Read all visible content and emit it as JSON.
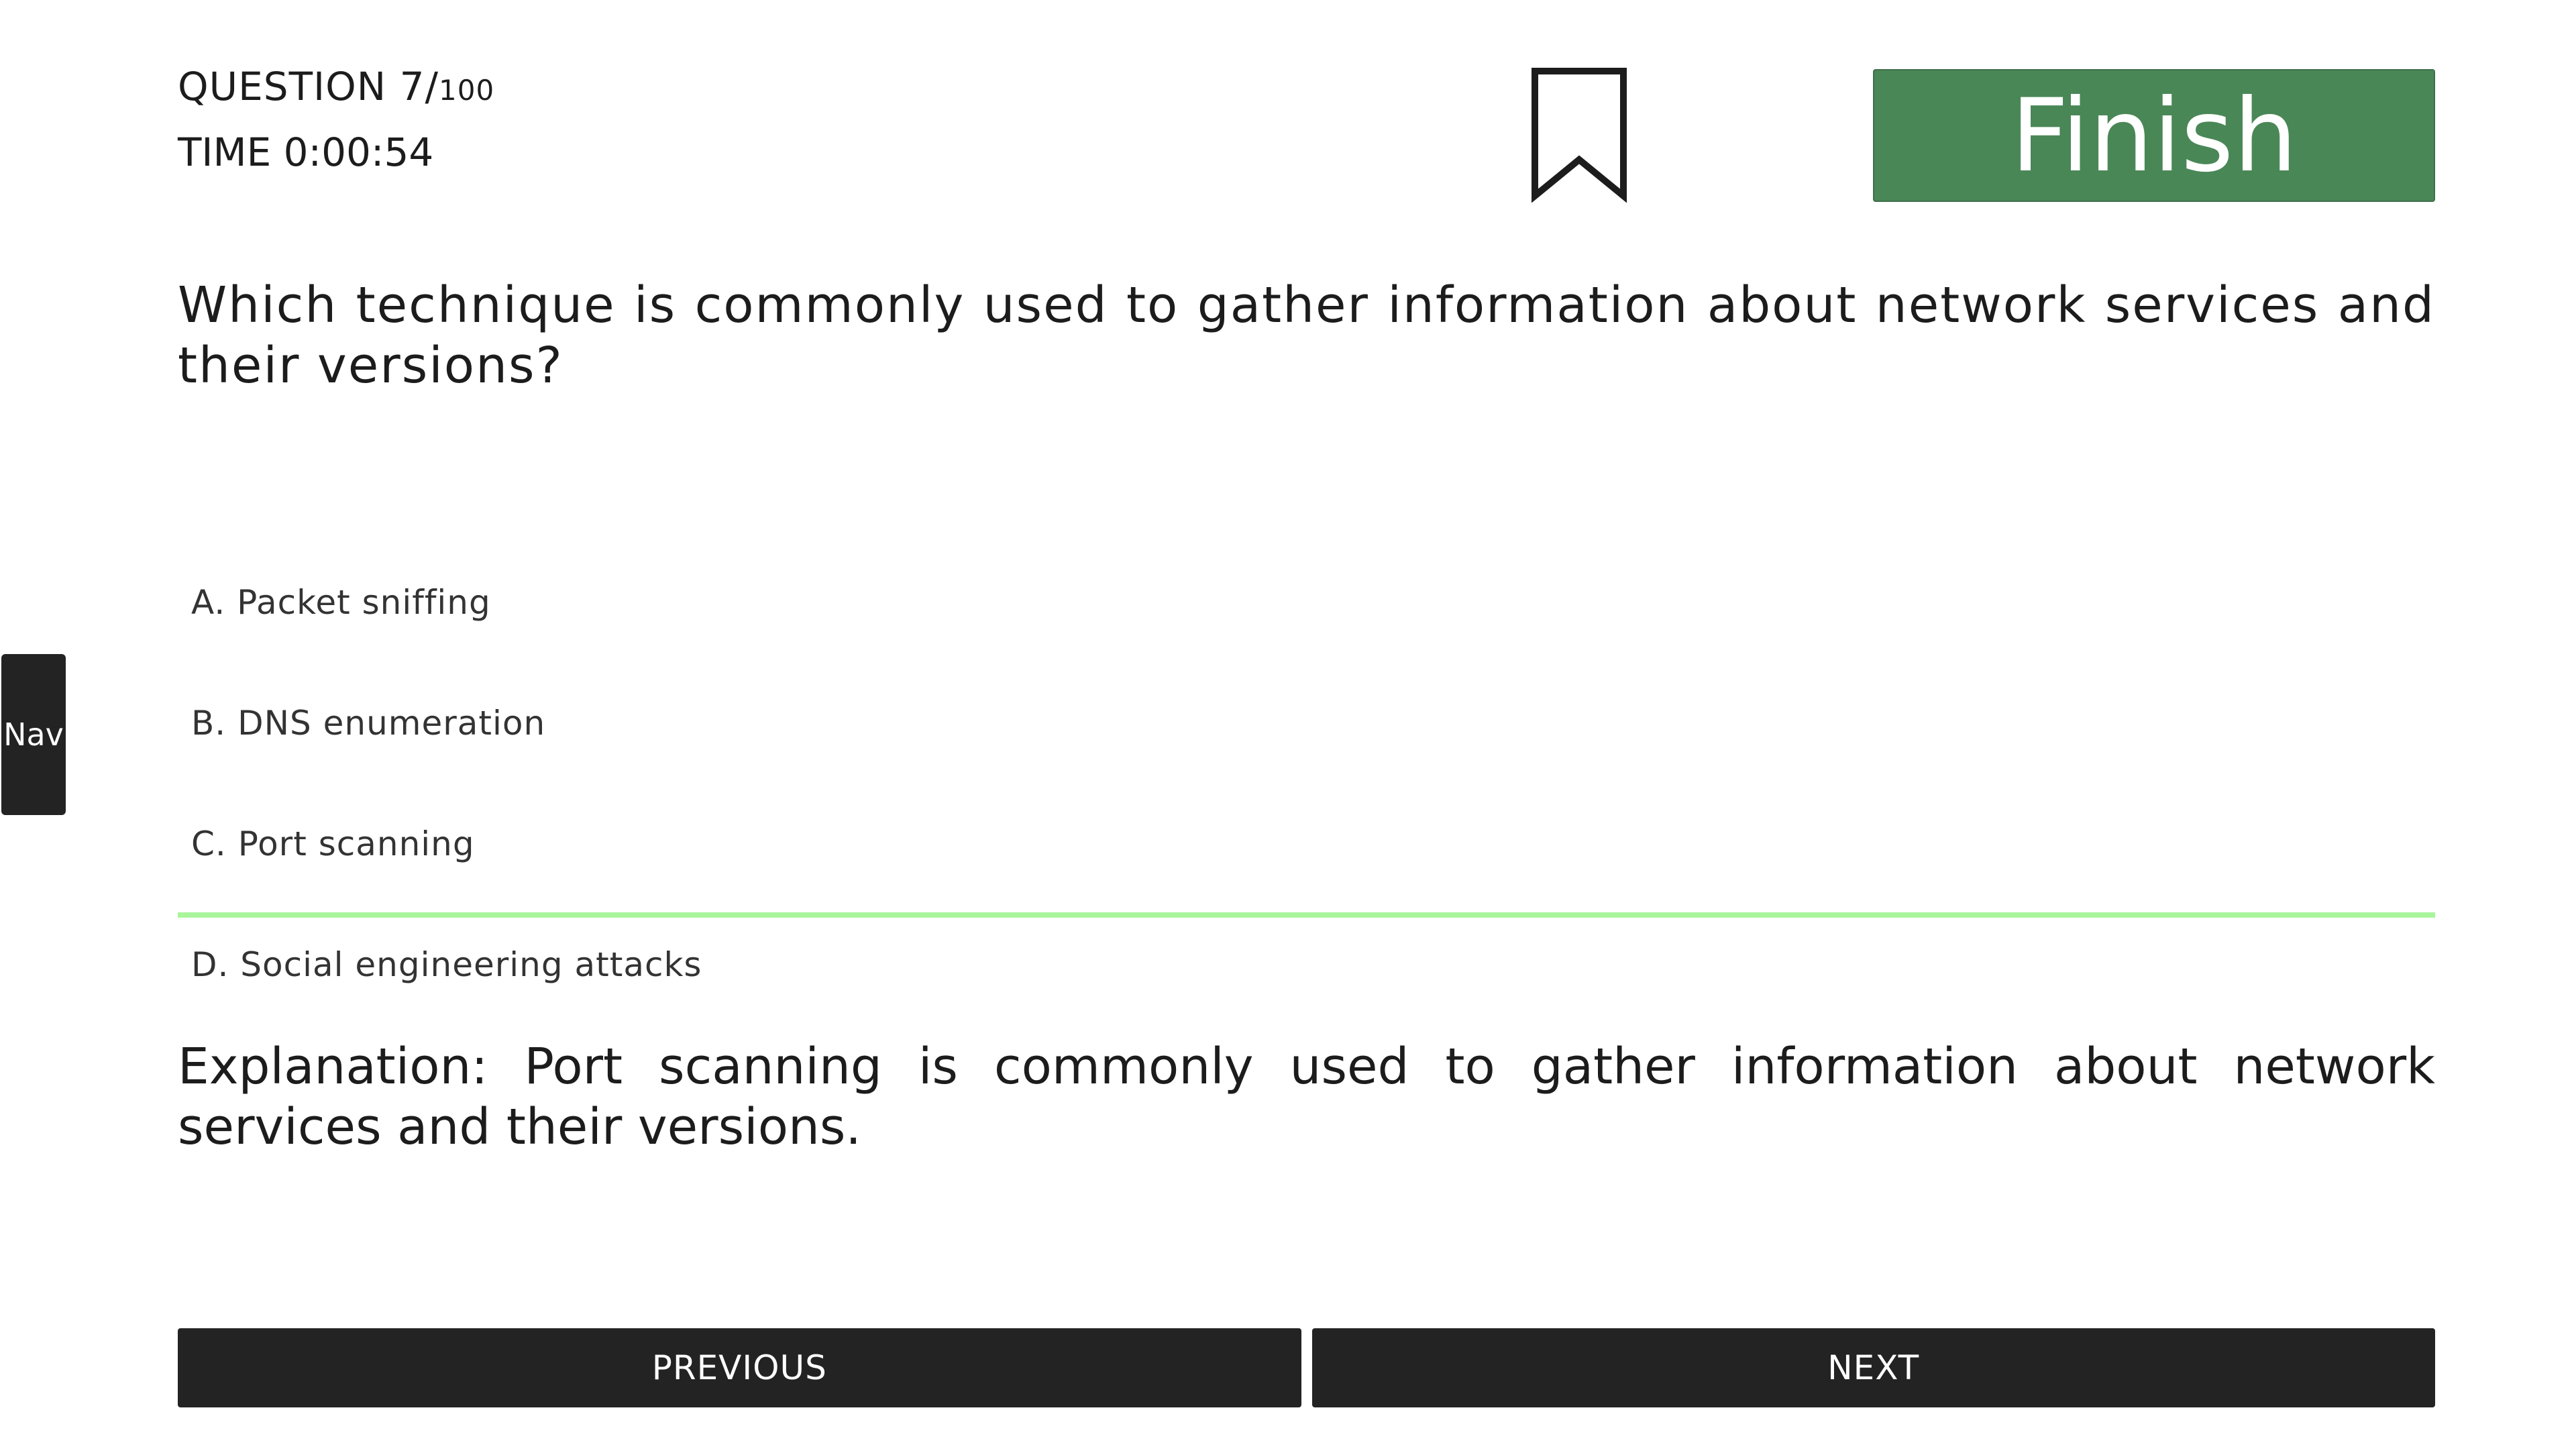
{
  "header": {
    "question_label": "QUESTION 7/",
    "question_total": "100",
    "timer": "TIME 0:00:54",
    "finish_label": "Finish"
  },
  "question": {
    "text": "Which technique is commonly used to gather information about network services and their versions?"
  },
  "nav_tab": {
    "label": "Nav"
  },
  "options": [
    {
      "label": "A. Packet sniffing"
    },
    {
      "label": "B. DNS enumeration"
    },
    {
      "label": "C. Port scanning"
    },
    {
      "label": "D. Social engineering attacks"
    }
  ],
  "correct_option_highlight_color": "#a9f59b",
  "explanation": {
    "text": "Explanation: Port scanning is commonly used to gather information about network services and their versions."
  },
  "footer": {
    "previous_label": "PREVIOUS",
    "next_label": "NEXT"
  },
  "colors": {
    "finish_button": "#4a8757",
    "dark_button": "#232323"
  }
}
